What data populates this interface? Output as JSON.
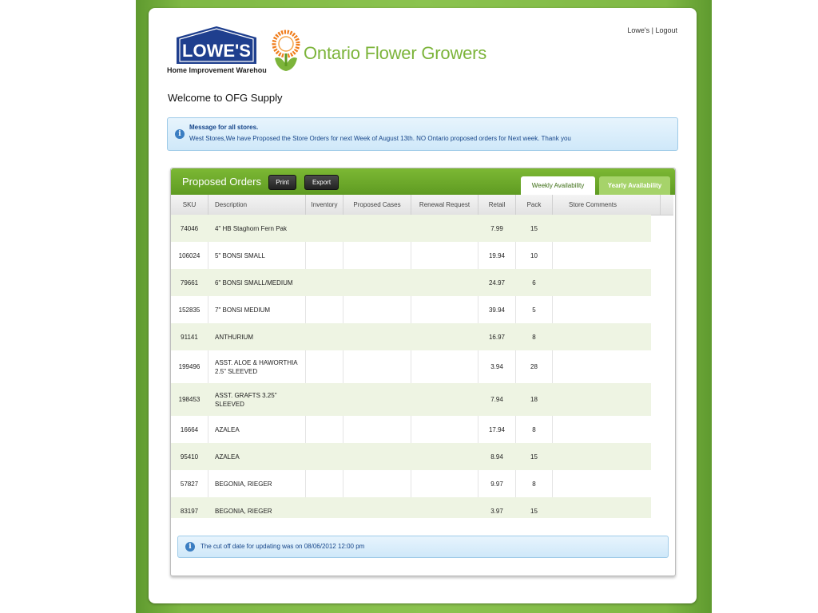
{
  "header": {
    "lowes_logo_text": "LOWE'S",
    "lowes_tagline": "Home Improvement Warehouse",
    "ofg_name": "Ontario Flower Growers",
    "user_link": "Lowe's",
    "separator": "|",
    "logout_label": "Logout"
  },
  "welcome": "Welcome to OFG Supply",
  "message": {
    "icon": "info-icon",
    "title": "Message for all stores.",
    "text": "West Stores,We have Proposed the Store Orders for next Week of August 13th. NO Ontario proposed orders for Next week. Thank you"
  },
  "panel": {
    "title": "Proposed Orders",
    "print_label": "Print",
    "export_label": "Export",
    "tabs": [
      {
        "label": "Weekly Availability",
        "active": true
      },
      {
        "label": "Yearly Availability",
        "active": false
      }
    ],
    "columns": [
      "SKU",
      "Description",
      "Inventory",
      "Proposed Cases",
      "Renewal Request",
      "Retail",
      "Pack",
      "Store Comments"
    ],
    "rows": [
      {
        "sku": "74046",
        "description": "4\" HB Staghorn Fern Pak",
        "retail": "7.99",
        "pack": "15"
      },
      {
        "sku": "106024",
        "description": "5\" BONSI SMALL",
        "retail": "19.94",
        "pack": "10"
      },
      {
        "sku": "79661",
        "description": "6\" BONSI SMALL/MEDIUM",
        "retail": "24.97",
        "pack": "6"
      },
      {
        "sku": "152835",
        "description": "7\" BONSI MEDIUM",
        "retail": "39.94",
        "pack": "5"
      },
      {
        "sku": "91141",
        "description": "ANTHURIUM",
        "retail": "16.97",
        "pack": "8"
      },
      {
        "sku": "199496",
        "description": "ASST. ALOE & HAWORTHIA 2.5\" SLEEVED",
        "retail": "3.94",
        "pack": "28"
      },
      {
        "sku": "198453",
        "description": "ASST. GRAFTS 3.25\" SLEEVED",
        "retail": "7.94",
        "pack": "18"
      },
      {
        "sku": "16664",
        "description": "AZALEA",
        "retail": "17.94",
        "pack": "8"
      },
      {
        "sku": "95410",
        "description": "AZALEA",
        "retail": "8.94",
        "pack": "15"
      },
      {
        "sku": "57827",
        "description": "BEGONIA, RIEGER",
        "retail": "9.97",
        "pack": "8"
      },
      {
        "sku": "83197",
        "description": "BEGONIA, RIEGER",
        "retail": "3.97",
        "pack": "15"
      }
    ],
    "cutoff": "The cut off date for updating was on 08/06/2012 12:00 pm"
  },
  "colors": {
    "brand_green": "#7cb43a",
    "header_green": "#6aa82a",
    "lowes_blue": "#1f3f8e",
    "info_blue": "#17468a"
  }
}
